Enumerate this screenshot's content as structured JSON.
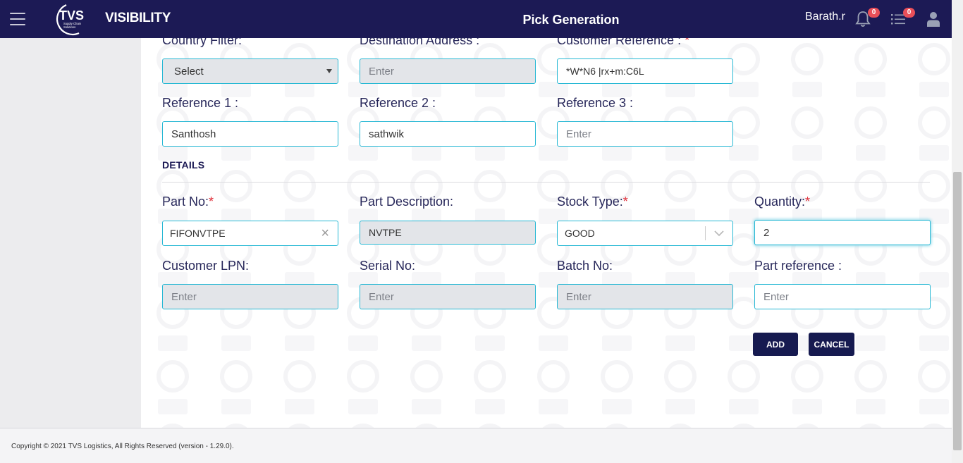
{
  "header": {
    "brand_logo_text": "TVS",
    "brand_logo_subtext": "Supply Chain Solutions",
    "brand_name": "VISIBILITY",
    "page_title": "Pick Generation",
    "user_name": "Barath.r",
    "notifications_count": "0",
    "tasks_count": "0"
  },
  "form": {
    "country_filter": {
      "label": "Country Filter:",
      "value": "Select"
    },
    "destination_address": {
      "label": "Destination Address :",
      "placeholder": "Enter"
    },
    "customer_reference": {
      "label": "Customer Reference :",
      "required_mark": "*",
      "value": "*W*N6 |rx+m:C6L"
    },
    "reference_1": {
      "label": "Reference 1 :",
      "value": "Santhosh"
    },
    "reference_2": {
      "label": "Reference 2 :",
      "value": "sathwik"
    },
    "reference_3": {
      "label": "Reference 3 :",
      "placeholder": "Enter"
    }
  },
  "details": {
    "section_title": "DETAILS",
    "part_no": {
      "label": "Part No:",
      "required_mark": "*",
      "value": "FIFONVTPE",
      "clear_symbol": "×"
    },
    "part_description": {
      "label": "Part Description:",
      "value": "NVTPE"
    },
    "stock_type": {
      "label": "Stock Type:",
      "required_mark": "*",
      "value": "GOOD"
    },
    "quantity": {
      "label": "Quantity:",
      "required_mark": "*",
      "value": "2"
    },
    "customer_lpn": {
      "label": "Customer LPN:",
      "placeholder": "Enter"
    },
    "serial_no": {
      "label": "Serial No:",
      "placeholder": "Enter"
    },
    "batch_no": {
      "label": "Batch No:",
      "placeholder": "Enter"
    },
    "part_reference": {
      "label": "Part reference :",
      "placeholder": "Enter"
    }
  },
  "actions": {
    "add_label": "ADD",
    "cancel_label": "CANCEL"
  },
  "footer": {
    "copyright": "Copyright © 2021 TVS Logistics, All Rights Reserved (version - 1.29.0)."
  },
  "colors": {
    "header_bg": "#1c1a55",
    "input_border": "#27b8d4",
    "badge": "#e94f59",
    "button_bg": "#161a50",
    "required": "#e0303a"
  },
  "icons": [
    "hamburger-icon",
    "bell-icon",
    "task-list-icon",
    "user-icon",
    "select-caret-icon",
    "clear-icon",
    "chevron-down-icon"
  ]
}
